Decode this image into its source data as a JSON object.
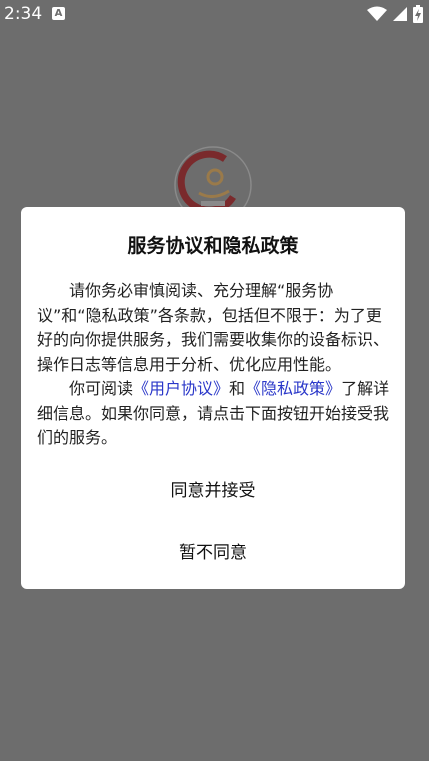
{
  "status_bar": {
    "time": "2:34",
    "app_notification": "A"
  },
  "dialog": {
    "title": "服务协议和隐私政策",
    "paragraph1": "请你务必审慎阅读、充分理解“服务协议”和“隐私政策”各条款，包括但不限于：为了更好的向你提供服务，我们需要收集你的设备标识、操作日志等信息用于分析、优化应用性能。",
    "paragraph2_prefix": "你可阅读",
    "link_user_agreement": "《用户协议》",
    "and_text": "和",
    "link_privacy_policy": "《隐私政策》",
    "paragraph2_suffix": "了解详细信息。如果你同意，请点击下面按钮开始接受我们的服务。",
    "agree_button": "同意并接受",
    "disagree_button": "暂不同意"
  },
  "colors": {
    "overlay": "#6d6d6d",
    "link": "#2a37c9",
    "logo_red": "#c0282e",
    "logo_gold": "#d9a441"
  },
  "icons": [
    "wifi-icon",
    "signal-icon",
    "battery-charging-icon"
  ]
}
